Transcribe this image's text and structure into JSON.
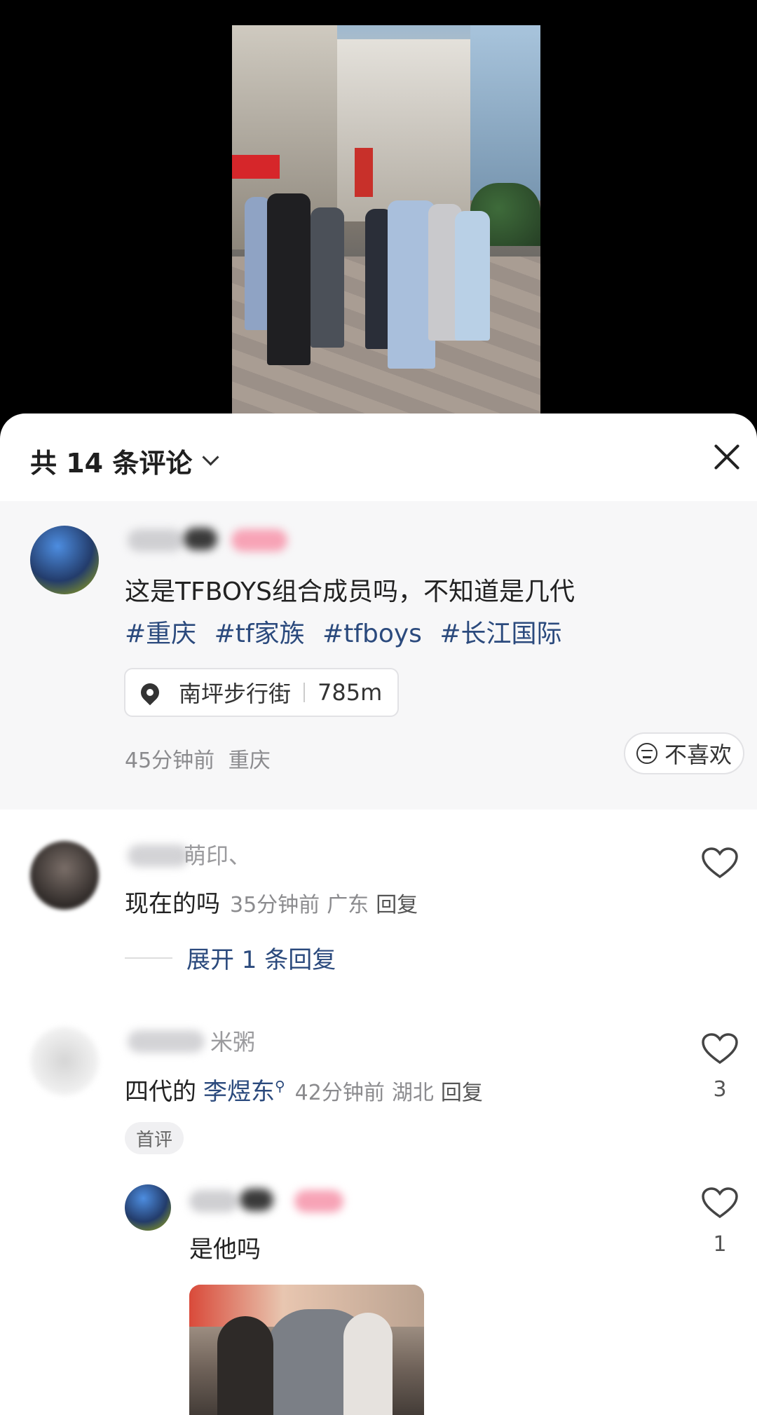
{
  "header": {
    "title": "共 14 条评论"
  },
  "post": {
    "text": "这是TFBOYS组合成员吗，不知道是几代",
    "tags": [
      "#重庆",
      "#tf家族",
      "#tfboys",
      "#长江国际"
    ],
    "location": {
      "name": "南坪步行街",
      "distance": "785m"
    },
    "time": "45分钟前",
    "region": "重庆",
    "dislike_label": "不喜欢"
  },
  "comments": [
    {
      "name_visible": "萌印、",
      "text": "现在的吗",
      "time": "35分钟前",
      "region": "广东",
      "reply_label": "回复",
      "expand_label": "展开 1 条回复"
    },
    {
      "name_visible": "米粥",
      "text": "四代的",
      "mention": "李煜东",
      "time": "42分钟前",
      "region": "湖北",
      "reply_label": "回复",
      "likes": "3",
      "badge": "首评"
    }
  ],
  "reply": {
    "text": "是他吗",
    "likes": "1"
  },
  "colors": {
    "link": "#2b4a7d",
    "meta": "#8b8b8e",
    "sheet_bg": "#ffffff",
    "post_bg": "#f7f7f8"
  }
}
